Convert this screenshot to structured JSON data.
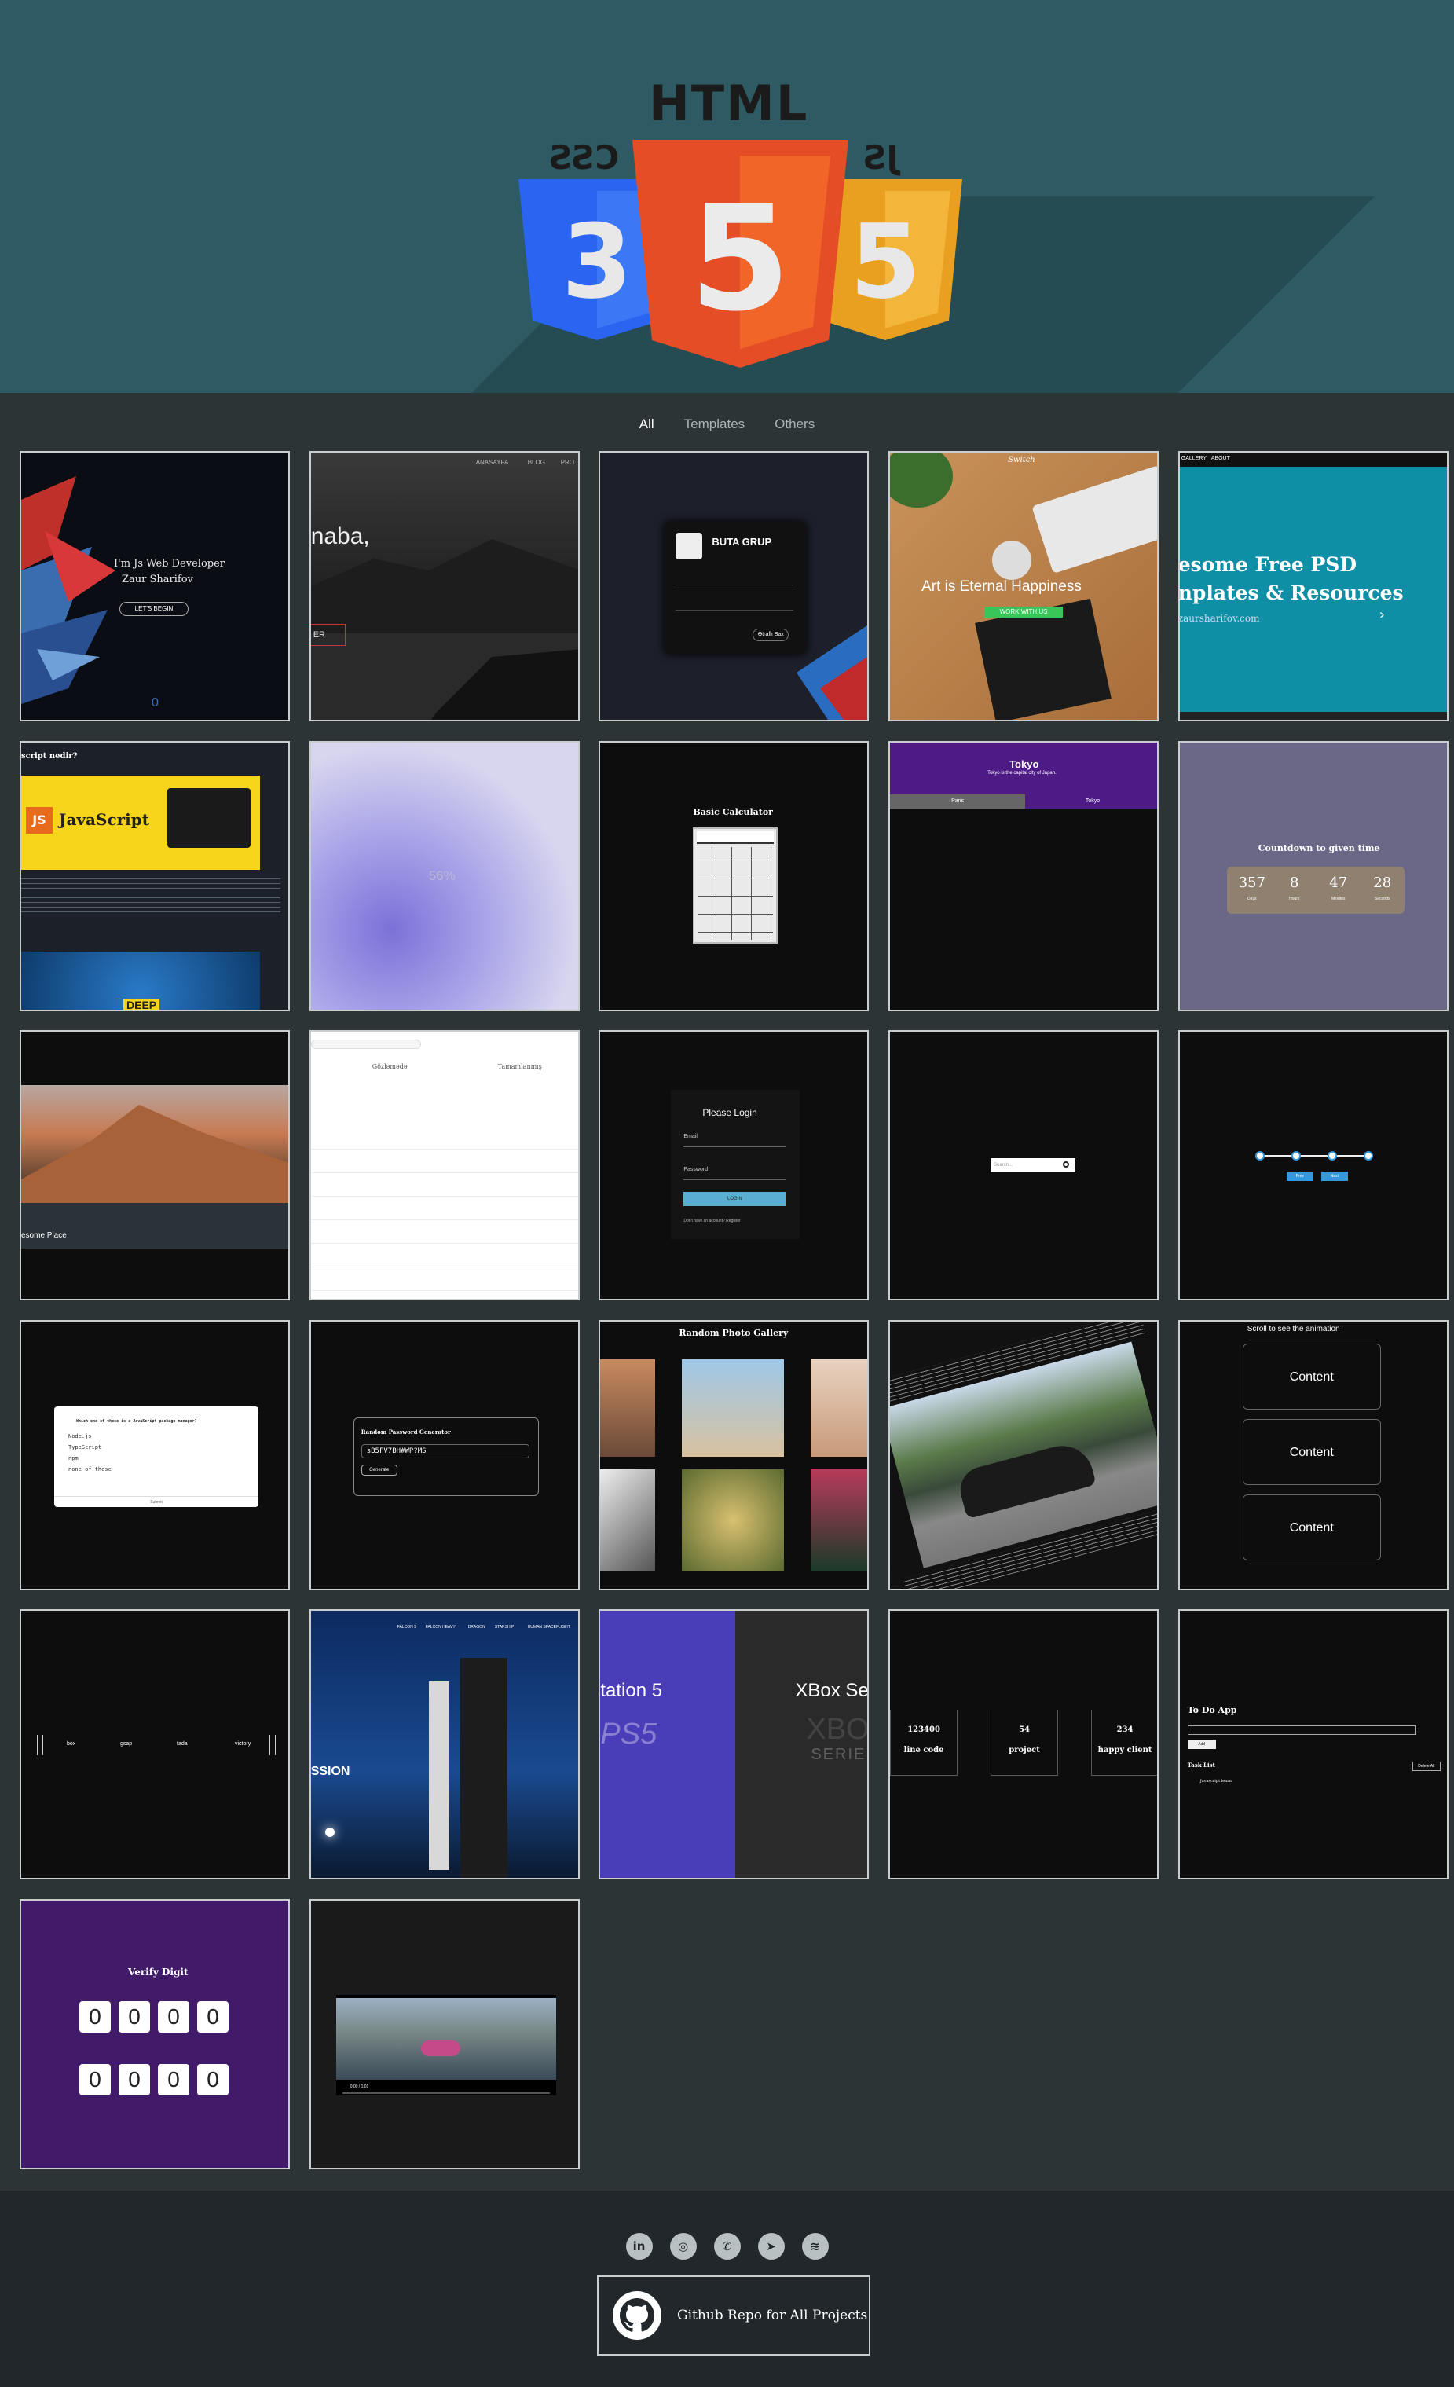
{
  "hero": {
    "html_text": "HTML",
    "css_text": "CSS",
    "js_text": "JS",
    "colors": {
      "background": "#2e5b63",
      "html5": "#e44d26",
      "css3": "#2965f1",
      "js": "#f0a30a"
    }
  },
  "tabs": [
    {
      "label": "All",
      "active": true
    },
    {
      "label": "Templates",
      "active": false
    },
    {
      "label": "Others",
      "active": false
    }
  ],
  "cards": [
    {
      "id": "zaur-portfolio",
      "lines": [
        "I'm Js Web Developer",
        "Zaur Sharifov",
        "LET'S BEGIN",
        "0"
      ]
    },
    {
      "id": "salam-landing",
      "lines": [
        "naba,",
        "ANASAYFA",
        "BLOG",
        "PRO",
        "ER"
      ]
    },
    {
      "id": "buta-grup-card",
      "lines": [
        "BUTA GRUP",
        "Ətraflı Bax"
      ]
    },
    {
      "id": "switch-happiness",
      "lines": [
        "Art is Eternal Happiness",
        "WORK WITH US",
        "Switch"
      ]
    },
    {
      "id": "free-psd",
      "lines": [
        "esome Free PSD",
        "nplates & Resources",
        "zaursharifov.com",
        "GALLERY",
        "ABOUT",
        "›"
      ]
    },
    {
      "id": "javascript-blog",
      "lines": [
        "script nedir?",
        "JavaScript",
        "JS",
        "DEEP"
      ]
    },
    {
      "id": "loading-56",
      "lines": [
        "56%"
      ]
    },
    {
      "id": "basic-calculator",
      "lines": [
        "Basic Calculator"
      ]
    },
    {
      "id": "tokyo-tabs",
      "lines": [
        "Tokyo",
        "Tokyo is the capital city of Japan.",
        "Paris",
        "Tokyo"
      ]
    },
    {
      "id": "countdown",
      "lines": [
        "Countdown to given time",
        "357",
        "8",
        "47",
        "28",
        "Days",
        "Hours",
        "Minutes",
        "Seconds"
      ]
    },
    {
      "id": "awesome-place",
      "lines": [
        "esome Place"
      ]
    },
    {
      "id": "admin-table",
      "lines": [
        "Gözləmədə",
        "Tamamlanmış"
      ]
    },
    {
      "id": "please-login",
      "lines": [
        "Please Login",
        "Email",
        "Password",
        "LOGIN",
        "Don't have an account? Register"
      ]
    },
    {
      "id": "search-box",
      "lines": [
        "Search..."
      ]
    },
    {
      "id": "progress-steps",
      "lines": [
        "Prev",
        "Next"
      ]
    },
    {
      "id": "quiz",
      "lines": [
        "Which one of these is a JavaScript package manager?",
        "Node.js",
        "TypeScript",
        "npm",
        "none of these",
        "Submit"
      ]
    },
    {
      "id": "password-generator",
      "lines": [
        "Random Password Generator",
        "sB5FV7BH#WP?MS",
        "Generate"
      ]
    },
    {
      "id": "photo-gallery",
      "lines": [
        "Random Photo Gallery"
      ]
    },
    {
      "id": "supra-article",
      "lines": []
    },
    {
      "id": "scroll-animation",
      "lines": [
        "Scroll to see the animation",
        "Content",
        "Content",
        "Content"
      ]
    },
    {
      "id": "gsap-nav",
      "lines": [
        "box",
        "gsap",
        "tada",
        "victory"
      ]
    },
    {
      "id": "spacex",
      "lines": [
        "SSION",
        "FALCON 9",
        "FALCON HEAVY",
        "DRAGON",
        "STARSHIP",
        "HUMAN SPACEFLIGHT"
      ]
    },
    {
      "id": "console-compare",
      "lines": [
        "tation 5",
        "XBox Se",
        "PS5",
        "XBOX",
        "SERIE"
      ]
    },
    {
      "id": "counters",
      "lines": [
        "123400",
        "line code",
        "54",
        "project",
        "234",
        "happy client"
      ]
    },
    {
      "id": "todo-app",
      "lines": [
        "To Do App",
        "Add",
        "Task List",
        "Delete All",
        "Javascript learn"
      ]
    },
    {
      "id": "verify-digit",
      "lines": [
        "Verify Digit",
        "0",
        "0",
        "0",
        "0",
        "0",
        "0",
        "0",
        "0"
      ]
    },
    {
      "id": "video-player",
      "lines": [
        "0:00 / 1:01"
      ]
    }
  ],
  "footer": {
    "social": [
      "linkedin-icon",
      "instagram-icon",
      "whatsapp-icon",
      "telegram-icon",
      "spotify-icon"
    ],
    "repo_label": "Github Repo for All Projects"
  }
}
